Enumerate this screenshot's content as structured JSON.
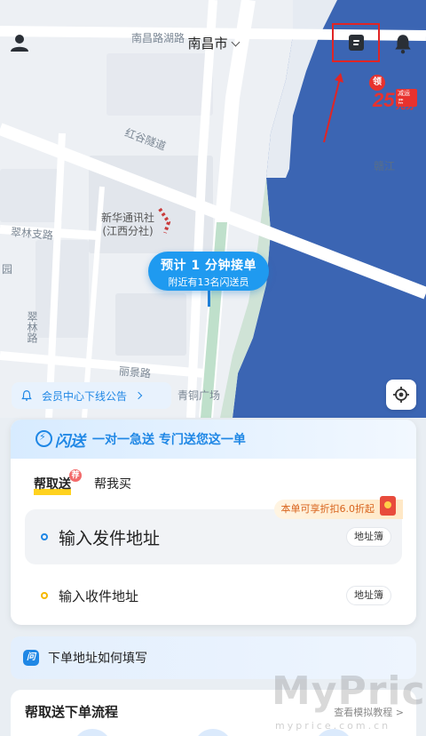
{
  "map": {
    "labels": {
      "top_road": "南昌路湖路",
      "tunnel": "红谷隧道",
      "river": "赣江",
      "poi_name": "新华通讯社",
      "poi_sub": "(江西分社)",
      "cuilin_road": "翠林支路",
      "yuan": "园",
      "cuilin_vertical": "翠林路",
      "lijing_road": "丽景路",
      "plaza": "青铜广场"
    },
    "colors": {
      "water": "#3b65b3",
      "road": "#ffffff",
      "land": "#edf0f4",
      "accent": "#1f9af0"
    }
  },
  "header": {
    "city": "南昌市",
    "user_icon": "user-icon",
    "orders_icon": "orders-icon",
    "bell_icon": "bell-icon"
  },
  "coupon": {
    "claim": "领",
    "amount": "25",
    "unit": "元券",
    "tag": "减运费"
  },
  "pickup": {
    "title": "预计 1 分钟接单",
    "subtitle": "附近有13名闪送员"
  },
  "notice": {
    "text": "会员中心下线公告"
  },
  "card": {
    "brand": "闪送",
    "slogan": "一对一急送 专门送您这一单",
    "tabs": [
      {
        "label": "帮取送",
        "badge": "荐",
        "active": true
      },
      {
        "label": "帮我买",
        "active": false
      }
    ],
    "discount": "本单可享折扣6.0折起",
    "sender": {
      "placeholder": "输入发件地址",
      "address_book": "地址簿"
    },
    "receiver": {
      "placeholder": "输入收件地址",
      "address_book": "地址簿"
    }
  },
  "howto": {
    "icon_text": "问",
    "text": "下单地址如何填写"
  },
  "flow": {
    "title": "帮取送下单流程",
    "link": "查看模拟教程 >"
  },
  "watermark": {
    "main": "MyPrice",
    "sub": "myprice.com.cn"
  }
}
